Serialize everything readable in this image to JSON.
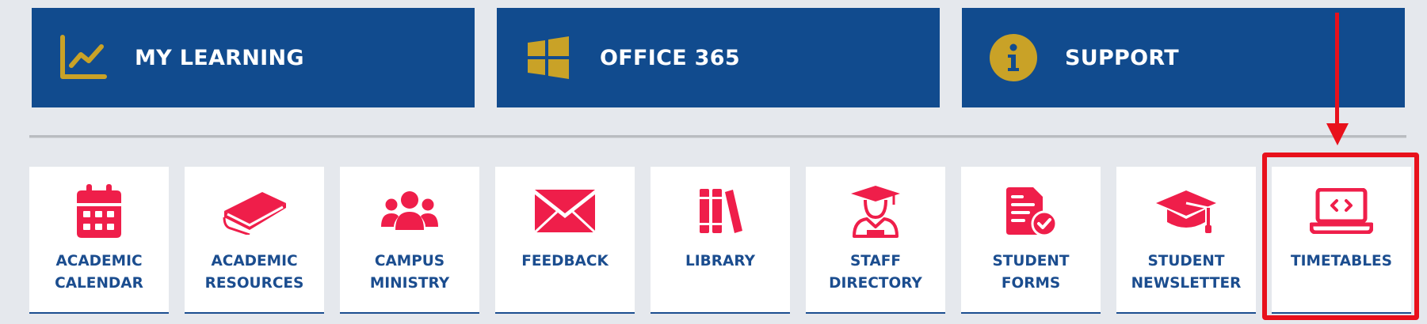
{
  "banners": [
    {
      "label": "MY LEARNING",
      "icon": "chart-line-icon",
      "icon_color": "#c9a227"
    },
    {
      "label": "OFFICE 365",
      "icon": "windows-logo-icon",
      "icon_color": "#c9a227"
    },
    {
      "label": "SUPPORT",
      "icon": "info-circle-icon",
      "icon_color": "#c9a227"
    }
  ],
  "tiles": [
    {
      "label": "ACADEMIC CALENDAR",
      "icon": "calendar-icon"
    },
    {
      "label": "ACADEMIC RESOURCES",
      "icon": "book-icon"
    },
    {
      "label": "CAMPUS MINISTRY",
      "icon": "group-users-icon"
    },
    {
      "label": "FEEDBACK",
      "icon": "envelope-icon"
    },
    {
      "label": "LIBRARY",
      "icon": "books-shelf-icon"
    },
    {
      "label": "STAFF DIRECTORY",
      "icon": "graduate-person-icon"
    },
    {
      "label": "STUDENT FORMS",
      "icon": "form-check-icon"
    },
    {
      "label": "STUDENT NEWSLETTER",
      "icon": "graduation-cap-icon"
    },
    {
      "label": "TIMETABLES",
      "icon": "laptop-code-icon"
    }
  ],
  "colors": {
    "banner_bg": "#114b8e",
    "tile_icon": "#ef1e4a",
    "tile_text": "#1b4d8f",
    "accent_gold": "#c9a227",
    "annotation": "#e8111c"
  }
}
